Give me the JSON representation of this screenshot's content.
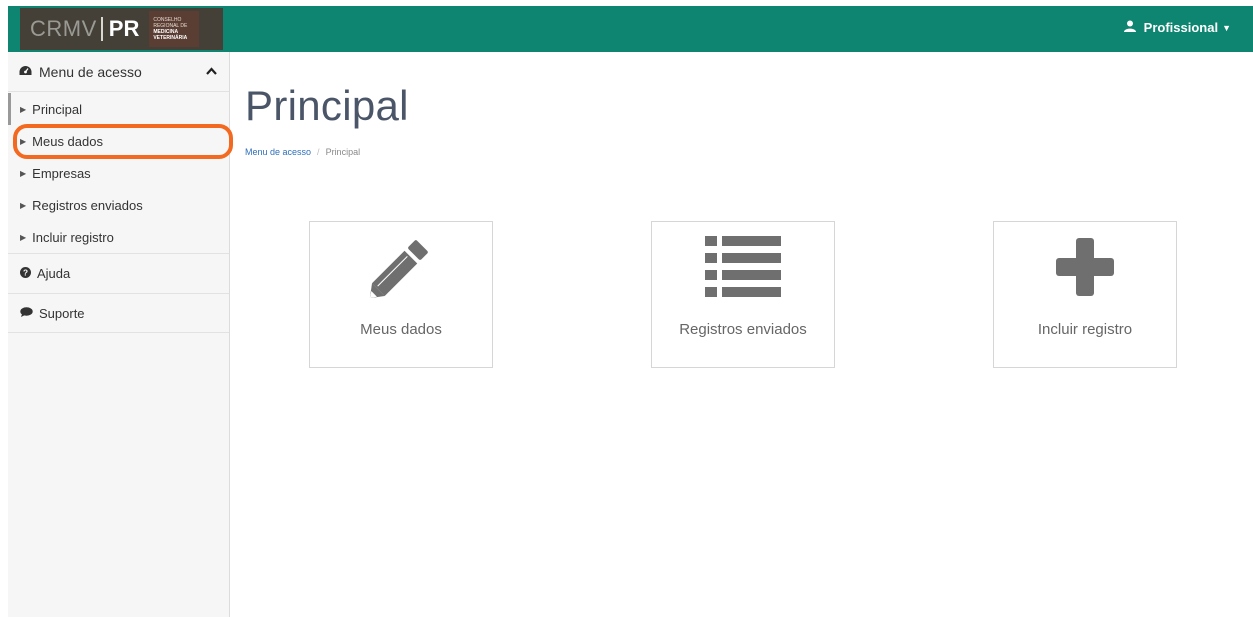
{
  "brand": {
    "name": "CRMV",
    "state": "PR",
    "subtitle": [
      "CONSELHO",
      "REGIONAL DE",
      "MEDICINA",
      "VETERINÁRIA"
    ]
  },
  "navbar": {
    "user_label": "Profissional",
    "bg_color": "#0e8571"
  },
  "sidebar": {
    "header": "Menu de acesso",
    "items": [
      {
        "label": "Principal"
      },
      {
        "label": "Meus dados"
      },
      {
        "label": "Empresas"
      },
      {
        "label": "Registros enviados"
      },
      {
        "label": "Incluir registro"
      }
    ],
    "sections": [
      {
        "label": "Ajuda",
        "icon": "question-circle-icon"
      },
      {
        "label": "Suporte",
        "icon": "comment-icon"
      }
    ]
  },
  "main": {
    "title": "Principal",
    "breadcrumb": [
      "Menu de acesso",
      "Principal"
    ],
    "tiles": [
      {
        "label": "Meus dados",
        "icon": "pencil-icon"
      },
      {
        "label": "Registros enviados",
        "icon": "list-icon"
      },
      {
        "label": "Incluir registro",
        "icon": "plus-icon"
      }
    ]
  },
  "highlight_color": "#f2691f"
}
